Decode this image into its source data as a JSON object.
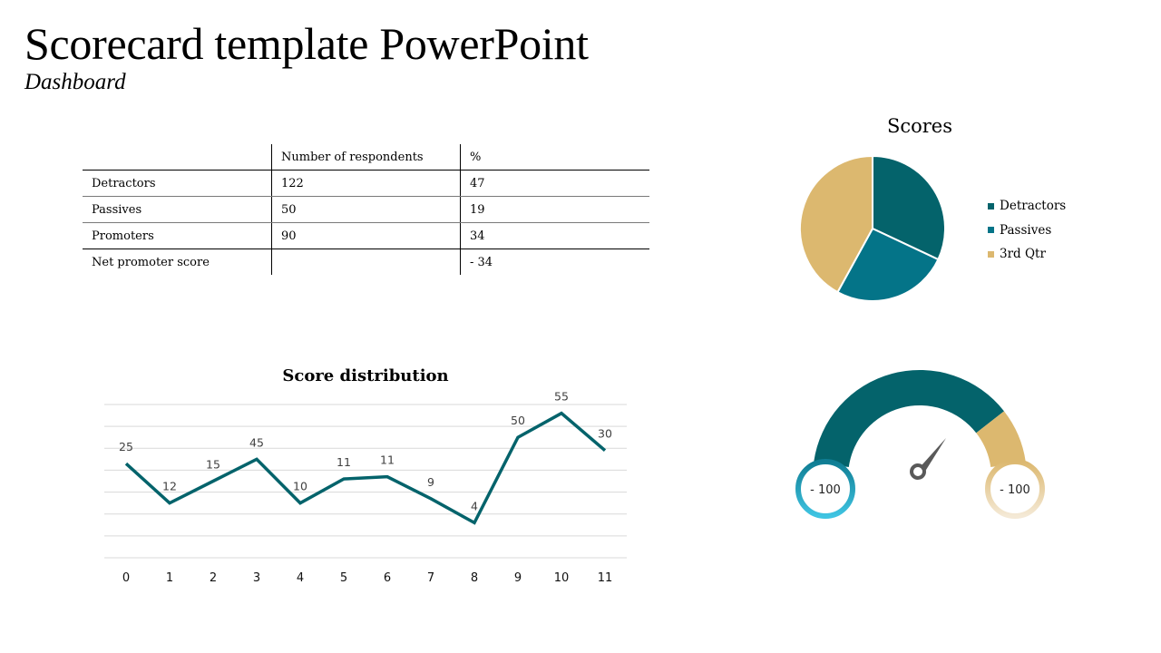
{
  "header": {
    "title": "Scorecard template PowerPoint",
    "subtitle": "Dashboard"
  },
  "table": {
    "columns": [
      "",
      "Number of respondents",
      "%"
    ],
    "rows": [
      [
        "Detractors",
        "122",
        "47"
      ],
      [
        "Passives",
        "50",
        "19"
      ],
      [
        "Promoters",
        "90",
        "34"
      ],
      [
        "Net promoter score",
        "",
        "- 34"
      ]
    ]
  },
  "gauge": {
    "left_label": "- 100",
    "right_label": "- 100",
    "colors": {
      "main": "#04636b",
      "end": "#dcb86f",
      "left_ring": "#1d9fbf",
      "right_ring": "#dcb86f",
      "needle": "#595959"
    }
  },
  "chart_data": [
    {
      "type": "pie",
      "title": "Scores",
      "legend_position": "right",
      "categories": [
        "Detractors",
        "Passives",
        "3rd Qtr"
      ],
      "values": [
        32,
        26,
        42
      ],
      "colors": [
        "#04636b",
        "#047488",
        "#dcb86f"
      ]
    },
    {
      "type": "line",
      "title": "Score distribution",
      "x": [
        0,
        1,
        2,
        3,
        4,
        5,
        6,
        7,
        8,
        9,
        10,
        11
      ],
      "data_labels": [
        "25",
        "12",
        "15",
        "45",
        "10",
        "11",
        "11",
        "9",
        "4",
        "50",
        "55",
        "30"
      ],
      "plotted_levels": [
        4.3,
        2.5,
        3.5,
        4.5,
        2.5,
        3.6,
        3.7,
        2.7,
        1.6,
        5.5,
        6.6,
        4.9
      ],
      "ylim": [
        0,
        7
      ],
      "gridlines": 8,
      "grid": true,
      "xlabel": "",
      "ylabel": "",
      "line_color": "#04636b"
    }
  ]
}
